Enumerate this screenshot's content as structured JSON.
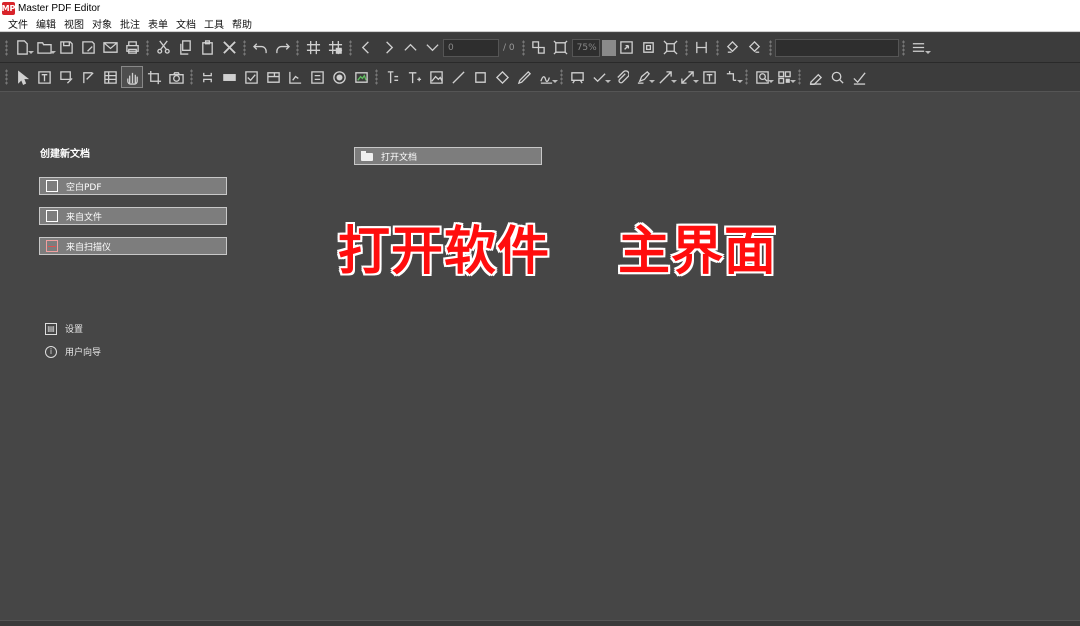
{
  "window": {
    "title": "Master PDF Editor",
    "logo": "MP"
  },
  "menu": [
    "文件",
    "编辑",
    "视图",
    "对象",
    "批注",
    "表单",
    "文档",
    "工具",
    "帮助"
  ],
  "toolbar": {
    "page_value": "0",
    "page_total": "/ 0",
    "zoom_value": "75%"
  },
  "start": {
    "section_title": "创建新文档",
    "blank_pdf": "空白PDF",
    "from_file": "来自文件",
    "from_scanner": "来自扫描仪",
    "open_document": "打开文档",
    "settings": "设置",
    "user_guide": "用户向导"
  },
  "overlay": {
    "left": "打开软件",
    "right": "主界面",
    "color": "#ff0d0d"
  },
  "icons": {
    "toolbar1": [
      "new-document-icon",
      "open-folder-icon",
      "save-icon",
      "save-as-icon",
      "email-icon",
      "print-icon",
      "cut-icon",
      "copy-icon",
      "paste-icon",
      "delete-icon",
      "undo-icon",
      "redo-icon",
      "grid-icon",
      "snap-grid-icon",
      "prev-page-icon",
      "next-page-icon",
      "first-page-icon",
      "last-page-icon",
      "fit-page-icon",
      "actual-size-icon",
      "zoom-in-icon",
      "fit-width-icon",
      "fit-height-icon",
      "rotate-left-icon",
      "rotate-right-icon",
      "search-icon",
      "menu-icon"
    ],
    "toolbar2": [
      "select-icon",
      "text-select-icon",
      "edit-text-icon",
      "edit-object-icon",
      "table-icon",
      "hand-icon",
      "crop-icon",
      "snapshot-icon",
      "link-icon",
      "button-icon",
      "checkbox-icon",
      "listbox-icon",
      "signature-field-icon",
      "text-field-icon",
      "radio-icon",
      "image-field-icon",
      "add-text-icon",
      "typewriter-icon",
      "add-image-icon",
      "line-icon",
      "rectangle-icon",
      "polygon-icon",
      "pencil-icon",
      "signature-icon",
      "stamp-icon",
      "checkmark-icon",
      "attach-icon",
      "highlight-icon",
      "arrow-line-icon",
      "measure-icon",
      "textbox-icon",
      "crop-tool-icon",
      "ocr-icon",
      "qr-icon",
      "eraser-icon",
      "zoom-tool-icon",
      "check-tool-icon"
    ]
  }
}
